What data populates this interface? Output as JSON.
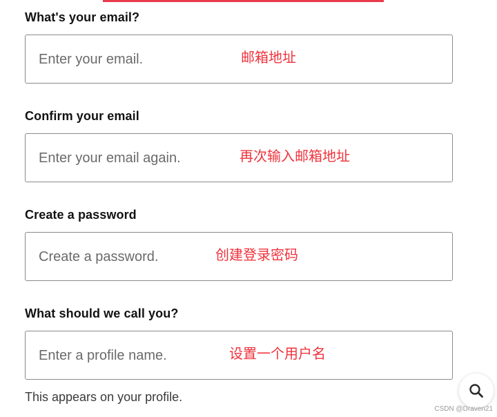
{
  "form": {
    "fields": [
      {
        "label": "What's your email?",
        "placeholder": "Enter your email.",
        "annotation": "邮箱地址"
      },
      {
        "label": "Confirm your email",
        "placeholder": "Enter your email again.",
        "annotation": "再次输入邮箱地址"
      },
      {
        "label": "Create a password",
        "placeholder": "Create a password.",
        "annotation": "创建登录密码"
      },
      {
        "label": "What should we call you?",
        "placeholder": "Enter a profile name.",
        "annotation": "设置一个用户名"
      }
    ],
    "helper_text": "This appears on your profile."
  },
  "search_button": {
    "icon": "search-icon"
  },
  "watermark": "CSDN @Draven21",
  "colors": {
    "annotation": "#f0323c",
    "label": "#121212",
    "placeholder": "#6a6a6a",
    "border": "#8a8a8a",
    "top_line": "#e83a4a"
  }
}
